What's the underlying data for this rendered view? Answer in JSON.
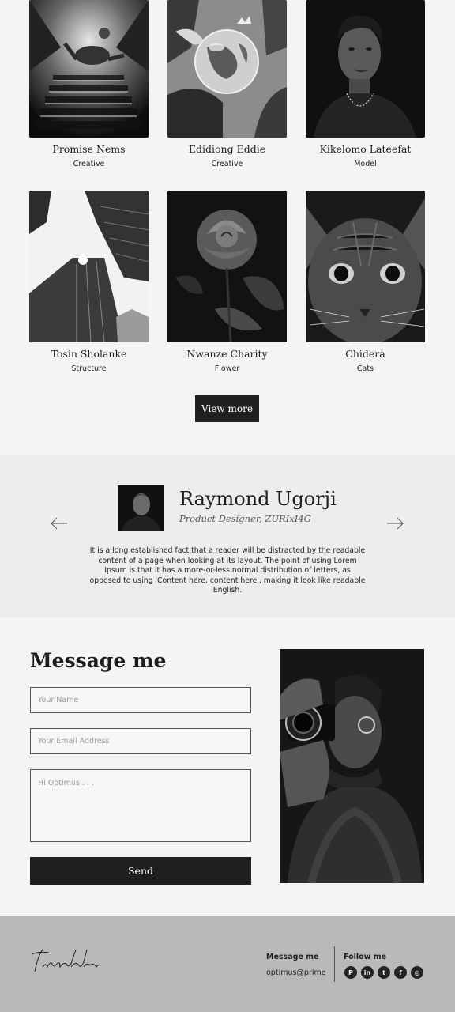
{
  "gallery": {
    "cards": [
      {
        "name": "Promise Nems",
        "role": "Creative",
        "photo": "staircase-photo"
      },
      {
        "name": "Edidiong Eddie",
        "role": "Creative",
        "photo": "glass-globe-photo"
      },
      {
        "name": "Kikelomo Lateefat",
        "role": "Model",
        "photo": "woman-portrait-photo"
      },
      {
        "name": "Tosin Sholanke",
        "role": "Structure",
        "photo": "skyscrapers-photo"
      },
      {
        "name": "Nwanze Charity",
        "role": "Flower",
        "photo": "rose-photo"
      },
      {
        "name": "Chidera",
        "role": "Cats",
        "photo": "cat-photo"
      }
    ],
    "view_more": "View more"
  },
  "testimonial": {
    "name": "Raymond Ugorji",
    "role": "Product Designer, ZURIxI4G",
    "quote": "It is a long established fact that a reader will be distracted by the readable content of a page when looking at its layout. The point of using Lorem Ipsum is that it has a more-or-less normal distribution of letters, as opposed to using 'Content here, content here', making it look like readable English.",
    "prev_icon": "arrow-left-icon",
    "next_icon": "arrow-right-icon"
  },
  "contact": {
    "title": "Message me",
    "name_placeholder": "Your Name",
    "email_placeholder": "Your Email Address",
    "message_placeholder": "Hi Optimus . . .",
    "send_label": "Send"
  },
  "footer": {
    "logo_text": "Ironhide",
    "message_title": "Message me",
    "email": "optimus@prime",
    "follow_title": "Follow me",
    "socials": [
      {
        "name": "pinterest-icon",
        "glyph": "P"
      },
      {
        "name": "linkedin-icon",
        "glyph": "in"
      },
      {
        "name": "twitter-icon",
        "glyph": "t"
      },
      {
        "name": "facebook-icon",
        "glyph": "f"
      },
      {
        "name": "instagram-icon",
        "glyph": "◎"
      }
    ]
  },
  "colors": {
    "background": "#f4f4f4",
    "testimonial_bg": "#ededed",
    "footer_bg": "#b9b9b9",
    "button": "#1f1f1f"
  }
}
